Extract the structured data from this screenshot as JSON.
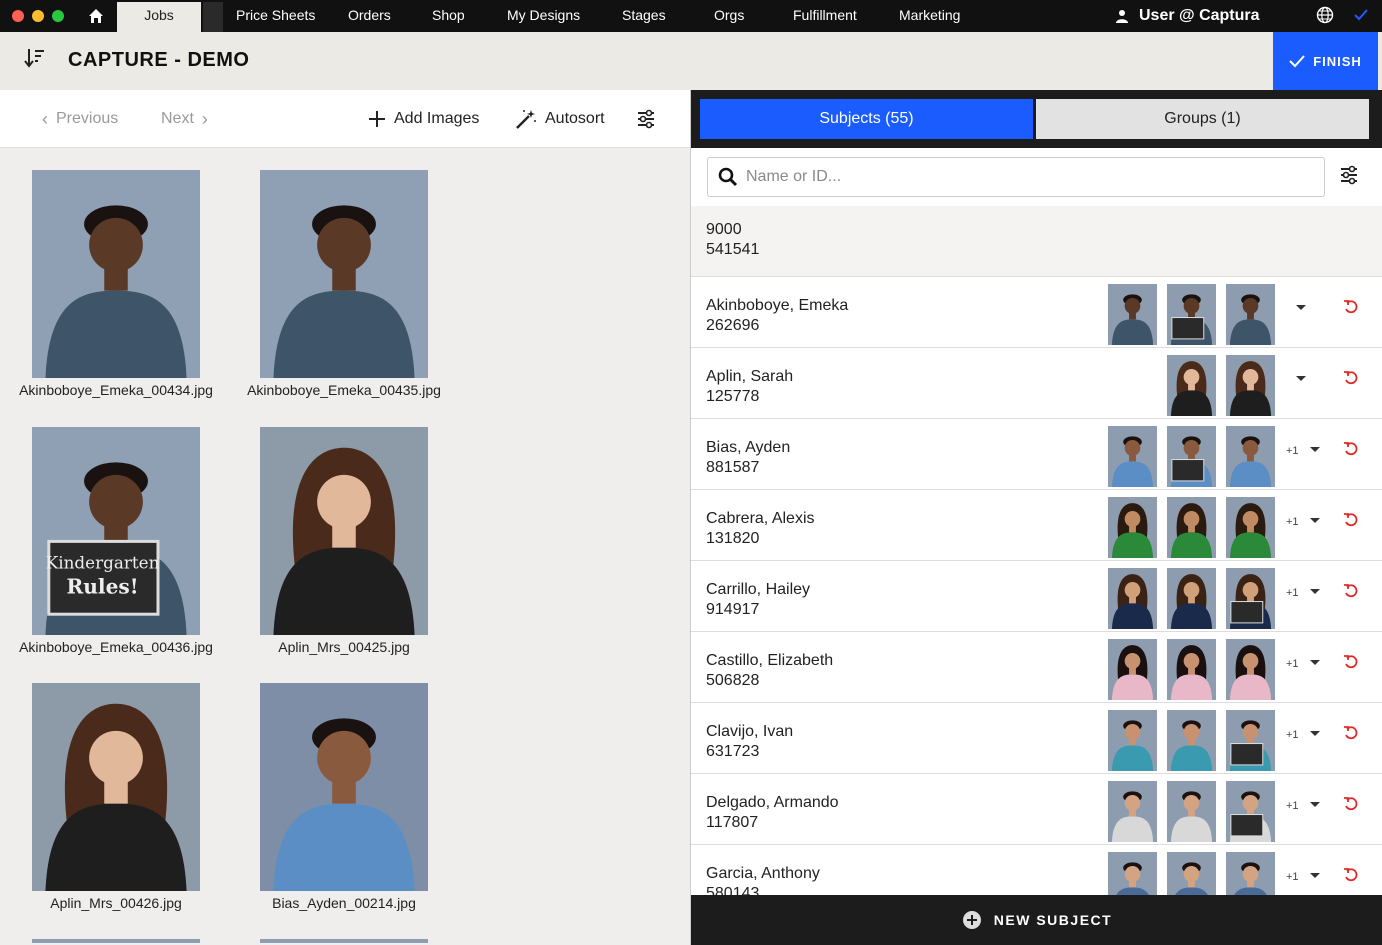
{
  "nav": {
    "home_icon": "home-icon",
    "active_tab": "Jobs",
    "items": [
      "Price Sheets",
      "Orders",
      "Shop",
      "My Designs",
      "Stages",
      "Orgs",
      "Fulfillment",
      "Marketing"
    ],
    "user_label": "User @ Captura",
    "colors": {
      "close": "#ff5f57",
      "minimize": "#febc2e",
      "zoom": "#28c840",
      "accent": "#1a5cff"
    }
  },
  "header": {
    "title": "CAPTURE - DEMO",
    "finish_label": "FINISH"
  },
  "toolbar": {
    "previous_label": "Previous",
    "next_label": "Next",
    "add_images_label": "Add Images",
    "autosort_label": "Autosort"
  },
  "gallery": [
    {
      "filename": "Akinboboye_Emeka_00434.jpg",
      "bg": "#8fa0b4",
      "skin": "#5a3a26",
      "shirt": "#3e5468"
    },
    {
      "filename": "Akinboboye_Emeka_00435.jpg",
      "bg": "#8fa0b4",
      "skin": "#5a3a26",
      "shirt": "#3e5468"
    },
    {
      "filename": "Akinboboye_Emeka_00436.jpg",
      "bg": "#8fa0b4",
      "skin": "#5a3a26",
      "shirt": "#3e5468",
      "sign": "Kindergarten Rules!"
    },
    {
      "filename": "Aplin_Mrs_00425.jpg",
      "bg": "#8d9aa8",
      "skin": "#e2b89a",
      "shirt": "#1e1e1e",
      "hair": "#4a2a1a"
    },
    {
      "filename": "Aplin_Mrs_00426.jpg",
      "bg": "#8d9aa8",
      "skin": "#e2b89a",
      "shirt": "#1e1e1e",
      "hair": "#4a2a1a"
    },
    {
      "filename": "Bias_Ayden_00214.jpg",
      "bg": "#7e8ea6",
      "skin": "#8a5a3e",
      "shirt": "#5a8ec4"
    }
  ],
  "right_panel": {
    "subjects_tab": "Subjects (55)",
    "groups_tab": "Groups (1)",
    "search_placeholder": "Name or ID...",
    "first_row": {
      "line1": "9000",
      "line2": "541541"
    },
    "new_subject_label": "NEW SUBJECT",
    "subjects": [
      {
        "name": "Akinboboye, Emeka",
        "id": "262696",
        "thumb_count": 3,
        "extra": "",
        "skin": "#5a3a26",
        "shirt": "#3e5468",
        "sign_index": 1
      },
      {
        "name": "Aplin, Sarah",
        "id": "125778",
        "thumb_count": 2,
        "extra": "",
        "skin": "#e2b89a",
        "shirt": "#1e1e1e",
        "hair": "#4a2a1a",
        "sign_index": -1
      },
      {
        "name": "Bias, Ayden",
        "id": "881587",
        "thumb_count": 3,
        "extra": "+1",
        "skin": "#8a5a3e",
        "shirt": "#5a8ec4",
        "sign_index": 1
      },
      {
        "name": "Cabrera, Alexis",
        "id": "131820",
        "thumb_count": 3,
        "extra": "+1",
        "skin": "#c08a62",
        "shirt": "#2a8a3a",
        "hair": "#2a1a10",
        "sign_index": -1
      },
      {
        "name": "Carrillo, Hailey",
        "id": "914917",
        "thumb_count": 3,
        "extra": "+1",
        "skin": "#d0a07a",
        "shirt": "#1a2a4a",
        "hair": "#3a2214",
        "sign_index": 2
      },
      {
        "name": "Castillo, Elizabeth",
        "id": "506828",
        "thumb_count": 3,
        "extra": "+1",
        "skin": "#c89270",
        "shirt": "#e8b8c8",
        "hair": "#1a1010",
        "sign_index": -1
      },
      {
        "name": "Clavijo, Ivan",
        "id": "631723",
        "thumb_count": 3,
        "extra": "+1",
        "skin": "#c89270",
        "shirt": "#3a9ab0",
        "sign_index": 2
      },
      {
        "name": "Delgado, Armando",
        "id": "117807",
        "thumb_count": 3,
        "extra": "+1",
        "skin": "#d4a482",
        "shirt": "#d8d8d8",
        "sign_index": 2
      },
      {
        "name": "Garcia, Anthony",
        "id": "580143",
        "thumb_count": 3,
        "extra": "+1",
        "skin": "#d4a482",
        "shirt": "#4a6a9a",
        "sign_index": -1
      }
    ]
  }
}
